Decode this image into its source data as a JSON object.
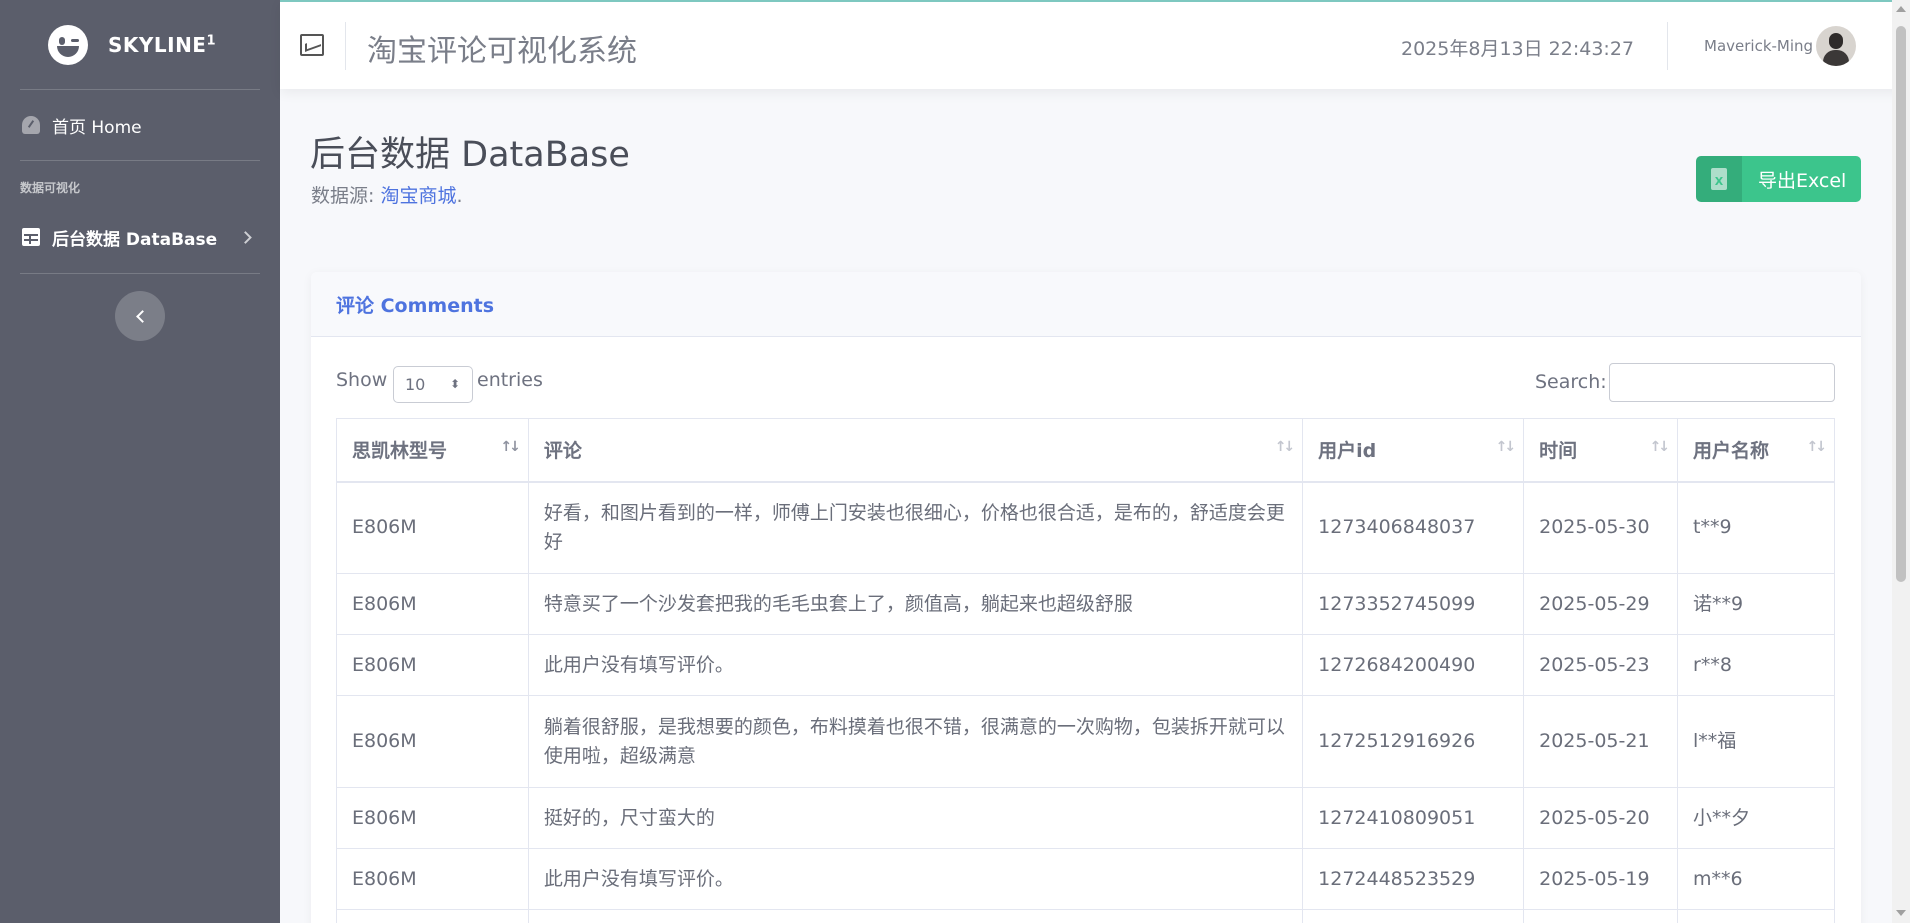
{
  "brand": {
    "name": "SKYLINE",
    "sup": "1"
  },
  "sidebar": {
    "home_label": "首页 Home",
    "section_heading": "数据可视化",
    "database_label": "后台数据 DataBase"
  },
  "topbar": {
    "title": "淘宝评论可视化系统",
    "datetime": "2025年8月13日 22:43:27",
    "username": "Maverick-Ming"
  },
  "page": {
    "title": "后台数据 DataBase",
    "source_prefix": "数据源: ",
    "source_link": "淘宝商城",
    "source_suffix": ".",
    "export_label": "导出Excel",
    "export_icon_letter": "X"
  },
  "card": {
    "title": "评论 Comments",
    "show_label": "Show",
    "entries_label": "entries",
    "length_value": "10",
    "search_label": "Search:"
  },
  "table": {
    "headers": [
      "思凯林型号",
      "评论",
      "用户id",
      "时间",
      "用户名称"
    ],
    "rows": [
      [
        "E806M",
        "好看，和图片看到的一样，师傅上门安装也很细心，价格也很合适，是布的，舒适度会更好",
        "1273406848037",
        "2025-05-30",
        "t**9"
      ],
      [
        "E806M",
        "特意买了一个沙发套把我的毛毛虫套上了，颜值高，躺起来也超级舒服",
        "1273352745099",
        "2025-05-29",
        "诺**9"
      ],
      [
        "E806M",
        "此用户没有填写评价。",
        "1272684200490",
        "2025-05-23",
        "r**8"
      ],
      [
        "E806M",
        "躺着很舒服，是我想要的颜色，布料摸着也很不错，很满意的一次购物，包装拆开就可以使用啦，超级满意",
        "1272512916926",
        "2025-05-21",
        "l**福"
      ],
      [
        "E806M",
        "挺好的，尺寸蛮大的",
        "1272410809051",
        "2025-05-20",
        "小**夕"
      ],
      [
        "E806M",
        "此用户没有填写评价。",
        "1272448523529",
        "2025-05-19",
        "m**6"
      ]
    ]
  },
  "colors": {
    "sidebar": "#5b5e6b",
    "accent": "#4e73df",
    "export": "#3cc58c"
  },
  "icons": [
    "wink-logo-icon",
    "gauge-icon",
    "table-icon",
    "chevron-right-icon",
    "chevron-left-icon",
    "line-chart-icon",
    "excel-file-icon",
    "sort-icon"
  ]
}
